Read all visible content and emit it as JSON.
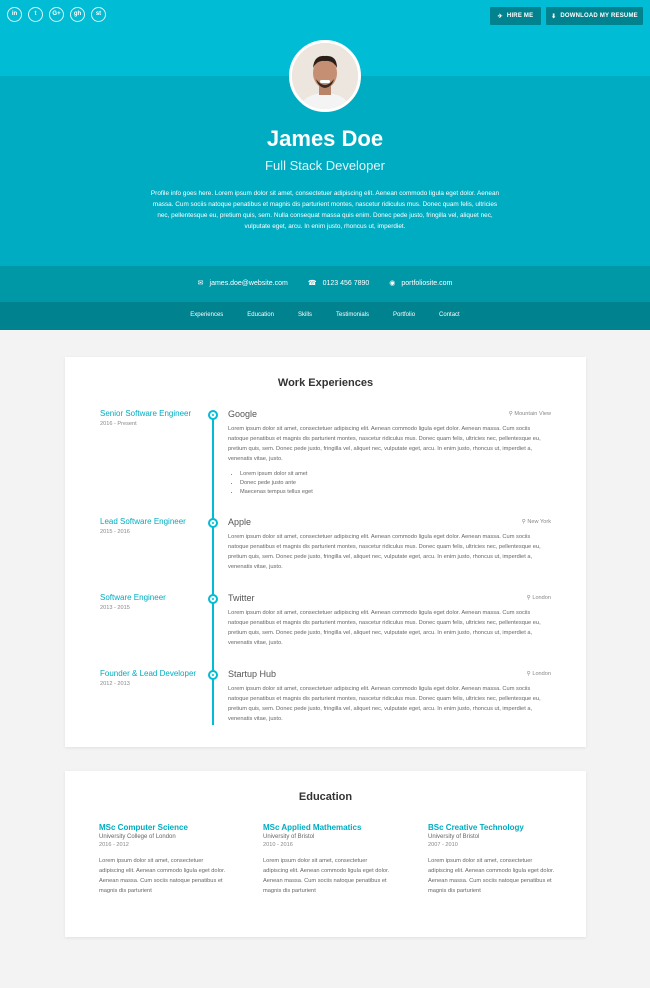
{
  "header": {
    "name": "James Doe",
    "title": "Full Stack Developer",
    "bio": "Profile info goes here. Lorem ipsum dolor sit amet, consectetuer adipiscing elit. Aenean commodo ligula eget dolor. Aenean massa. Cum sociis natoque penatibus et magnis dis parturient montes, nascetur ridiculus mus. Donec quam felis, ultricies nec, pellentesque eu, pretium quis, sem. Nulla consequat massa quis enim. Donec pede justo, fringilla vel, aliquet nec, vulputate eget, arcu. In enim justo, rhoncus ut, imperdiet.",
    "social": [
      "in",
      "t",
      "G+",
      "gh",
      "st"
    ],
    "hire_label": "HIRE ME",
    "download_label": "DOWNLOAD MY RESUME"
  },
  "contact": {
    "email": "james.doe@website.com",
    "phone": "0123 456 7890",
    "website": "portfoliosite.com"
  },
  "nav": [
    "Experiences",
    "Education",
    "Skills",
    "Testimonials",
    "Portfolio",
    "Contact"
  ],
  "experience": {
    "title": "Work Experiences",
    "jobs": [
      {
        "role": "Senior Software Engineer",
        "period": "2016 - Present",
        "company": "Google",
        "location": "Mountain View",
        "desc": "Lorem ipsum dolor sit amet, consectetuer adipiscing elit. Aenean commodo ligula eget dolor. Aenean massa. Cum sociis natoque penatibus et magnis dis parturient montes, nascetur ridiculus mus. Donec quam felis, ultricies nec, pellentesque eu, pretium quis, sem. Donec pede justo, fringilla vel, aliquet nec, vulputate eget, arcu. In enim justo, rhoncus ut, imperdiet a, venenatis vitae, justo.",
        "bullets": [
          "Lorem ipsum dolor sit amet",
          "Donec pede justo ante",
          "Maecenas tempus tellus eget"
        ]
      },
      {
        "role": "Lead Software Engineer",
        "period": "2015 - 2016",
        "company": "Apple",
        "location": "New York",
        "desc": "Lorem ipsum dolor sit amet, consectetuer adipiscing elit. Aenean commodo ligula eget dolor. Aenean massa. Cum sociis natoque penatibus et magnis dis parturient montes, nascetur ridiculus mus. Donec quam felis, ultricies nec, pellentesque eu, pretium quis, sem. Donec pede justo, fringilla vel, aliquet nec, vulputate eget, arcu. In enim justo, rhoncus ut, imperdiet a, venenatis vitae, justo."
      },
      {
        "role": "Software Engineer",
        "period": "2013 - 2015",
        "company": "Twitter",
        "location": "London",
        "desc": "Lorem ipsum dolor sit amet, consectetuer adipiscing elit. Aenean commodo ligula eget dolor. Aenean massa. Cum sociis natoque penatibus et magnis dis parturient montes, nascetur ridiculus mus. Donec quam felis, ultricies nec, pellentesque eu, pretium quis, sem. Donec pede justo, fringilla vel, aliquet nec, vulputate eget, arcu. In enim justo, rhoncus ut, imperdiet a, venenatis vitae, justo."
      },
      {
        "role": "Founder & Lead Developer",
        "period": "2012 - 2013",
        "company": "Startup Hub",
        "location": "London",
        "desc": "Lorem ipsum dolor sit amet, consectetuer adipiscing elit. Aenean commodo ligula eget dolor. Aenean massa. Cum sociis natoque penatibus et magnis dis parturient montes, nascetur ridiculus mus. Donec quam felis, ultricies nec, pellentesque eu, pretium quis, sem. Donec pede justo, fringilla vel, aliquet nec, vulputate eget, arcu. In enim justo, rhoncus ut, imperdiet a, venenatis vitae, justo."
      }
    ]
  },
  "education": {
    "title": "Education",
    "items": [
      {
        "degree": "MSc Computer Science",
        "school": "University College of London",
        "years": "2016 - 2012",
        "text": "Lorem ipsum dolor sit amet, consectetuer adipiscing elit. Aenean commodo ligula eget dolor. Aenean massa. Cum sociis natoque penatibus et magnis dis parturient"
      },
      {
        "degree": "MSc Applied Mathematics",
        "school": "University of Bristol",
        "years": "2010 - 2016",
        "text": "Lorem ipsum dolor sit amet, consectetuer adipiscing elit. Aenean commodo ligula eget dolor. Aenean massa. Cum sociis natoque penatibus et magnis dis parturient"
      },
      {
        "degree": "BSc Creative Technology",
        "school": "University of Bristol",
        "years": "2007 - 2010",
        "text": "Lorem ipsum dolor sit amet, consectetuer adipiscing elit. Aenean commodo ligula eget dolor. Aenean massa. Cum sociis natoque penatibus et magnis dis parturient"
      }
    ]
  },
  "colors": {
    "primary": "#00bcd4",
    "primary_dark": "#00acc1",
    "contact_bar": "#0097a7",
    "nav_bar": "#00838f"
  }
}
